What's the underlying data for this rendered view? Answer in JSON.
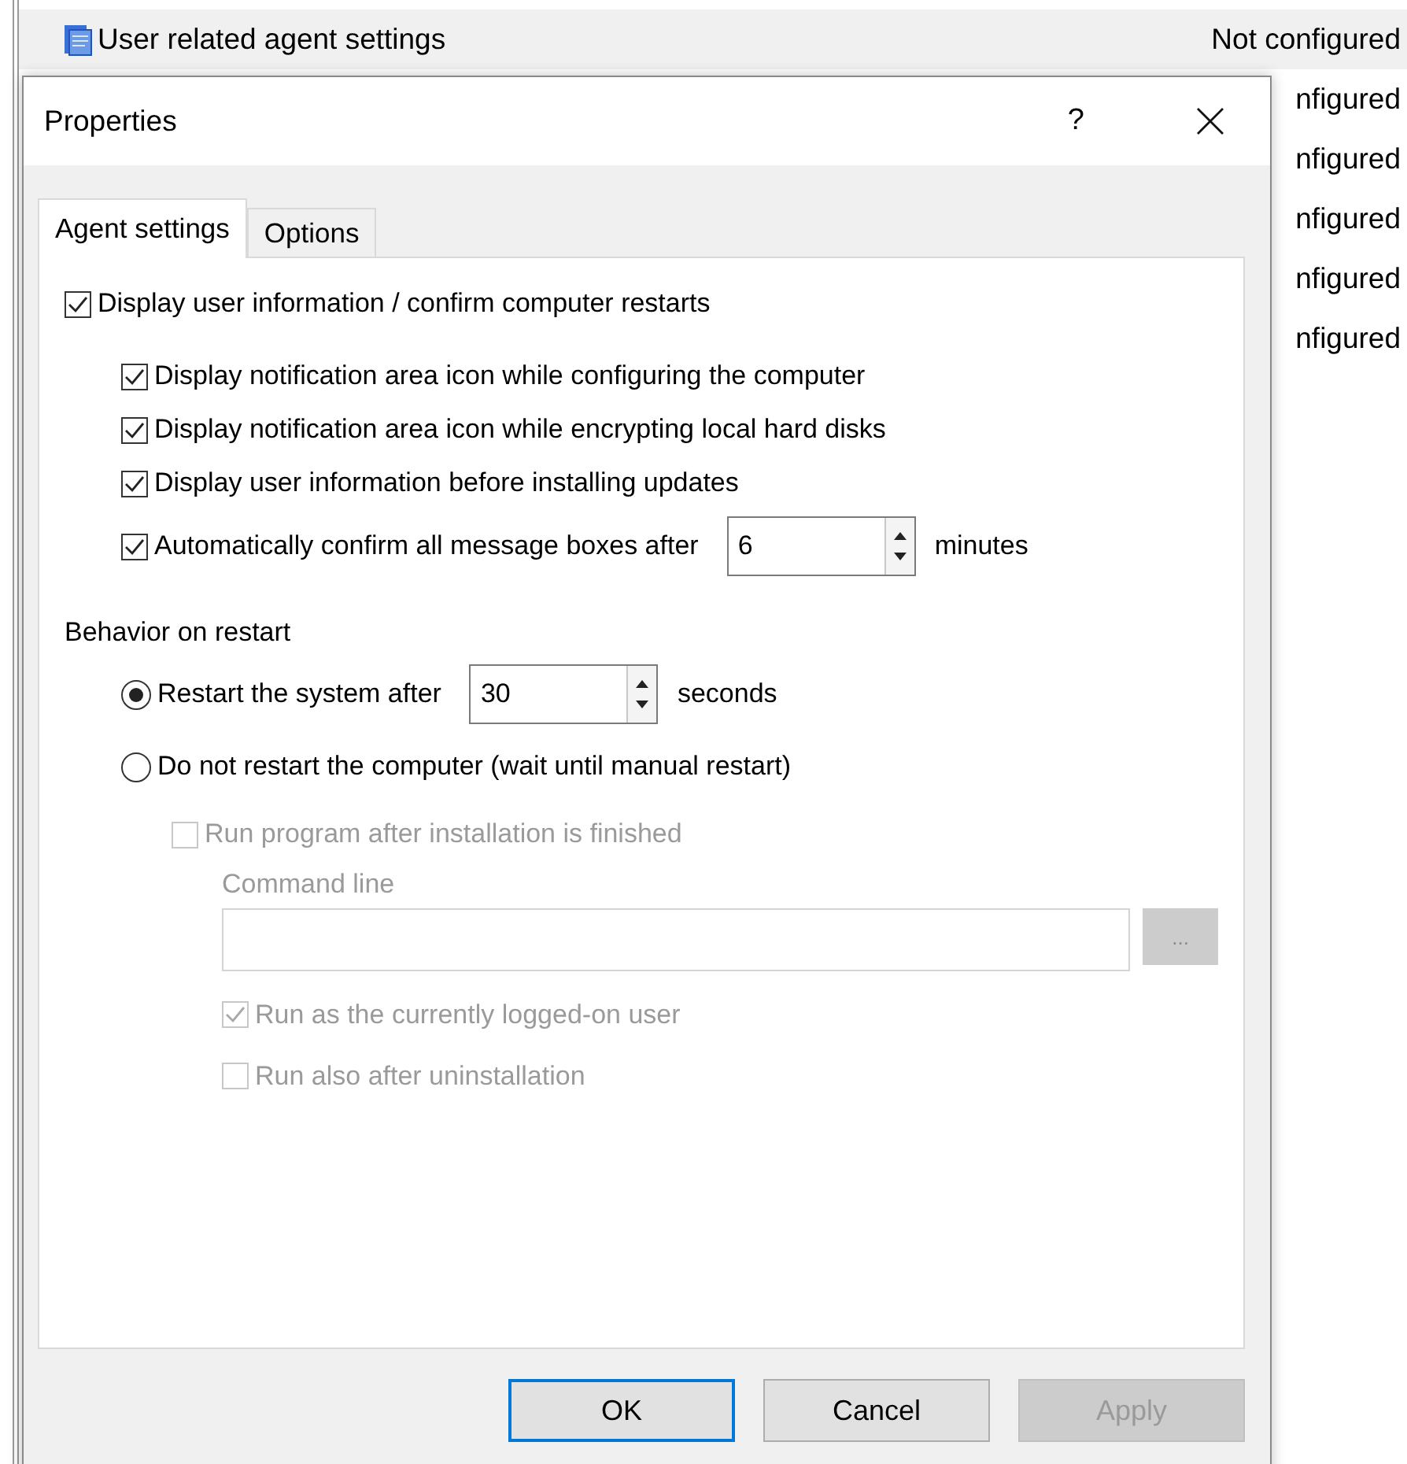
{
  "list": {
    "rows": [
      {
        "label": "User related agent settings",
        "value": "Not configured"
      },
      {
        "value": "nfigured"
      },
      {
        "value": "nfigured"
      },
      {
        "value": "nfigured"
      },
      {
        "value": "nfigured"
      },
      {
        "value": "nfigured"
      }
    ]
  },
  "dialog": {
    "title": "Properties",
    "help": "?",
    "tabs": [
      {
        "label": "Agent settings",
        "selected": true
      },
      {
        "label": "Options",
        "selected": false
      }
    ],
    "display": {
      "label": "Display user information / confirm computer restarts",
      "checked": true,
      "children": [
        {
          "label": "Display notification area icon while configuring the computer",
          "checked": true
        },
        {
          "label": "Display notification area icon while encrypting local hard disks",
          "checked": true
        },
        {
          "label": "Display user information before installing updates",
          "checked": true
        },
        {
          "label": "Automatically confirm all message boxes after",
          "checked": true,
          "spin": {
            "value": "6",
            "unit": "minutes"
          }
        }
      ]
    },
    "behavior": {
      "heading": "Behavior on restart",
      "options": [
        {
          "label": "Restart the system after",
          "selected": true,
          "spin": {
            "value": "30",
            "unit": "seconds"
          }
        },
        {
          "label": "Do not restart the computer (wait until manual restart)",
          "selected": false
        }
      ],
      "run_program": {
        "label": "Run program after installation is finished",
        "checked": false,
        "disabled": true,
        "command_line": {
          "label": "Command line",
          "browse": "...",
          "disabled": true
        },
        "children": [
          {
            "label": "Run as the currently logged-on user",
            "checked": true,
            "disabled": true
          },
          {
            "label": "Run also after uninstallation",
            "checked": false,
            "disabled": true
          }
        ]
      }
    },
    "buttons": [
      {
        "label": "OK",
        "default": true,
        "disabled": false
      },
      {
        "label": "Cancel",
        "default": false,
        "disabled": false
      },
      {
        "label": "Apply",
        "default": false,
        "disabled": true
      }
    ]
  }
}
